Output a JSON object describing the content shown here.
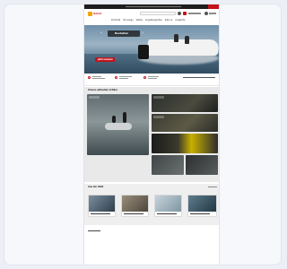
{
  "site": {
    "brand_name": "Solid",
    "nav_items": [
      "Produkte",
      "Tecnology",
      "Safety",
      "Angelbergerlöse",
      "Sale na",
      "Angebote"
    ],
    "hero": {
      "badge_text": "Neuheiten",
      "cta_label": "Jetzt ansehen"
    },
    "sections": {
      "featured_title": "Unsere aktuellen Artikel",
      "gallery_title": "Aus der Welt"
    },
    "colors": {
      "brand_red": "#c4121a",
      "brand_orange": "#f5a20a",
      "topbar": "#1e1e1e"
    },
    "icons": {
      "prev": "chevron-left-icon",
      "next": "chevron-right-icon",
      "search": "search-icon",
      "account": "user-icon",
      "cart": "cart-icon"
    }
  }
}
